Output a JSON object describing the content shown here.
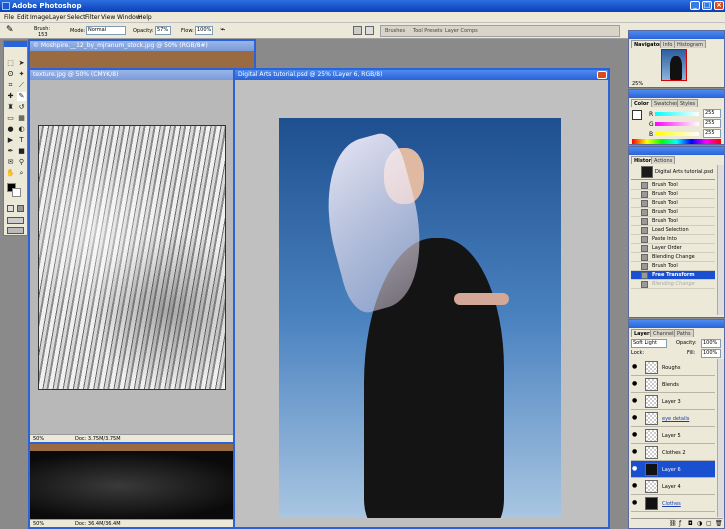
{
  "app": {
    "title": "Adobe Photoshop"
  },
  "menu": [
    "File",
    "Edit",
    "Image",
    "Layer",
    "Select",
    "Filter",
    "View",
    "Window",
    "Help"
  ],
  "options": {
    "brush_label": "Brush:",
    "brush_size": "153",
    "mode_label": "Mode:",
    "mode_value": "Normal",
    "opacity_label": "Opacity:",
    "opacity_value": "57%",
    "flow_label": "Flow:",
    "flow_value": "100%"
  },
  "palette_well": [
    "Brushes",
    "Tool Presets",
    "Layer Comps"
  ],
  "documents": {
    "mosh": {
      "title": "© Moshpire.__12_by_mjranum_stock.jpg @ 50% (RGB/8#)",
      "zoom": "50%",
      "doc": "Doc: 36.4M/36.4M"
    },
    "texture": {
      "title": "texture.jpg @ 50% (CMYK/8)",
      "zoom": "50%",
      "doc": "Doc: 3.75M/3.75M"
    },
    "main": {
      "title": "Digital Arts tutorial.psd @ 25% (Layer 6, RGB/8)"
    }
  },
  "navigator": {
    "tabs": [
      "Navigator",
      "Info",
      "Histogram"
    ],
    "zoom": "25%"
  },
  "color": {
    "tabs": [
      "Color",
      "Swatches",
      "Styles"
    ],
    "r_label": "R",
    "g_label": "G",
    "b_label": "B",
    "r": "255",
    "g": "255",
    "b": "255"
  },
  "history": {
    "tabs": [
      "History",
      "Actions"
    ],
    "snapshot": "Digital Arts tutorial.psd",
    "items": [
      "Brush Tool",
      "Brush Tool",
      "Brush Tool",
      "Brush Tool",
      "Brush Tool",
      "Load Selection",
      "Paste Into",
      "Layer Order",
      "Blending Change",
      "Brush Tool",
      "Free Transform",
      "Blending Change"
    ]
  },
  "layers": {
    "tabs": [
      "Layers",
      "Channels",
      "Paths"
    ],
    "blend": "Soft Light",
    "opacity_label": "Opacity:",
    "opacity": "100%",
    "lock_label": "Lock:",
    "fill_label": "Fill:",
    "fill": "100%",
    "items": [
      "Roughs",
      "Blends",
      "Layer 3",
      "eye details",
      "Layer 5",
      "Clothes 2",
      "Layer 6",
      "Layer 4",
      "Clothes"
    ]
  },
  "colors": {
    "title_blue": "#0a3fb8",
    "selection": "#1a4fd0",
    "panel_bg": "#ece9d8",
    "workspace": "#8a8a8a"
  }
}
